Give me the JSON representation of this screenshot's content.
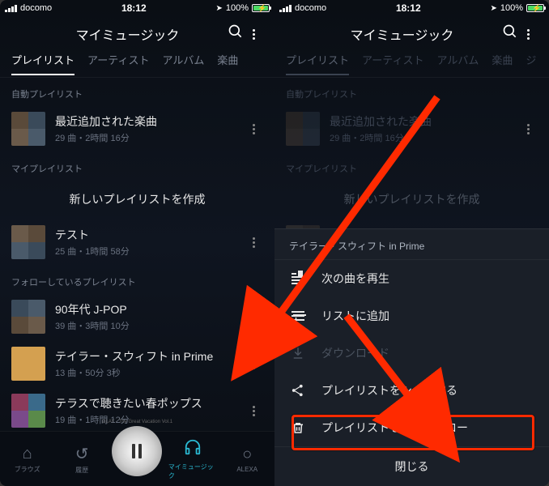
{
  "status": {
    "carrier": "docomo",
    "time": "18:12",
    "battery_pct": "100%"
  },
  "header": {
    "title": "マイミュージック"
  },
  "tabs": {
    "playlist": "プレイリスト",
    "artist": "アーティスト",
    "album": "アルバム",
    "track": "楽曲",
    "genre_short": "ジ"
  },
  "sections": {
    "auto": "自動プレイリスト",
    "mine": "マイプレイリスト",
    "following": "フォローしているプレイリスト"
  },
  "auto_item": {
    "title": "最近追加された楽曲",
    "sub": "29 曲・2時間 16分"
  },
  "new_playlist": "新しいプレイリストを作成",
  "mine_item": {
    "title": "テスト",
    "sub": "25 曲・1時間 58分"
  },
  "follow": [
    {
      "title": "90年代 J-POP",
      "sub": "39 曲・3時間 10分"
    },
    {
      "title": "テイラー・スウィフト in Prime",
      "sub": "13 曲・50分 3秒"
    },
    {
      "title": "テラスで聴きたい春ポップス",
      "sub": "19 曲・1時間 12分"
    }
  ],
  "mini_track": "GLAY - The Great Vacation Vol.1",
  "bottomnav": {
    "browse": "ブラウズ",
    "history": "履歴",
    "mymusic": "マイミュージック",
    "alexa": "ALEXA"
  },
  "sheet": {
    "title": "テイラー・スウィフト in Prime",
    "play_next": "次の曲を再生",
    "add_to_list": "リストに追加",
    "download": "ダウンロード",
    "share": "プレイリストをシェアする",
    "unfollow": "プレイリストをアンフォロー",
    "close": "閉じる"
  }
}
